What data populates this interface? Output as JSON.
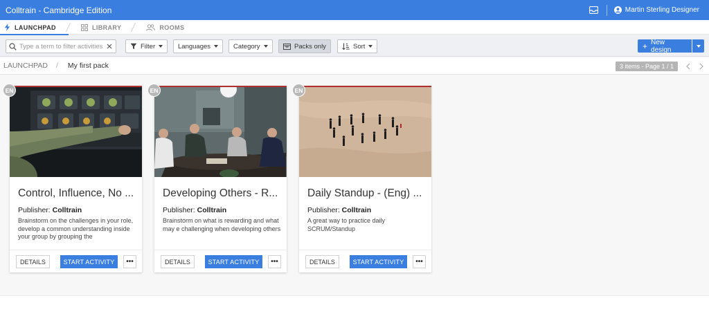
{
  "app": {
    "title": "Colltrain - Cambridge Edition"
  },
  "user": {
    "name": "Martin Sterling Designer",
    "icon": "user-circle-icon"
  },
  "tabs": [
    {
      "label": "LAUNCHPAD",
      "icon": "bolt-icon",
      "active": true
    },
    {
      "label": "LIBRARY",
      "icon": "grid-icon",
      "active": false
    },
    {
      "label": "ROOMS",
      "icon": "people-icon",
      "active": false
    }
  ],
  "toolbar": {
    "search_placeholder": "Type a term to filter activities",
    "filter_label": "Filter",
    "languages_label": "Languages",
    "category_label": "Category",
    "packs_only_label": "Packs only",
    "sort_label": "Sort",
    "new_design_label": "New design"
  },
  "breadcrumb": {
    "root": "LAUNCHPAD",
    "separator": "/",
    "current": "My first pack"
  },
  "pagination": {
    "info": "3 items - Page 1 / 1"
  },
  "cards": [
    {
      "language": "EN",
      "title": "Control, Influence, No ...",
      "publisher_label": "Publisher:",
      "publisher": "Colltrain",
      "description": "Brainstorm on the challenges in your role, develop a common understanding inside your group by grouping the",
      "details_label": "DETAILS",
      "start_label": "START ACTIVITY",
      "more_label": "•••"
    },
    {
      "language": "EN",
      "title": "Developing Others - R...",
      "publisher_label": "Publisher:",
      "publisher": "Colltrain",
      "description": "Brainstorm on what is rewarding and what may e challenging when developing others",
      "details_label": "DETAILS",
      "start_label": "START ACTIVITY",
      "more_label": "•••"
    },
    {
      "language": "EN",
      "title": "Daily Standup - (Eng) ...",
      "publisher_label": "Publisher:",
      "publisher": "Colltrain",
      "description": "A great way to practice daily SCRUM/Standup",
      "details_label": "DETAILS",
      "start_label": "START ACTIVITY",
      "more_label": "•••"
    }
  ],
  "colors": {
    "accent": "#3a7ee0",
    "card_top_line": "#b03030",
    "lang_badge": "#b8b8b8"
  }
}
